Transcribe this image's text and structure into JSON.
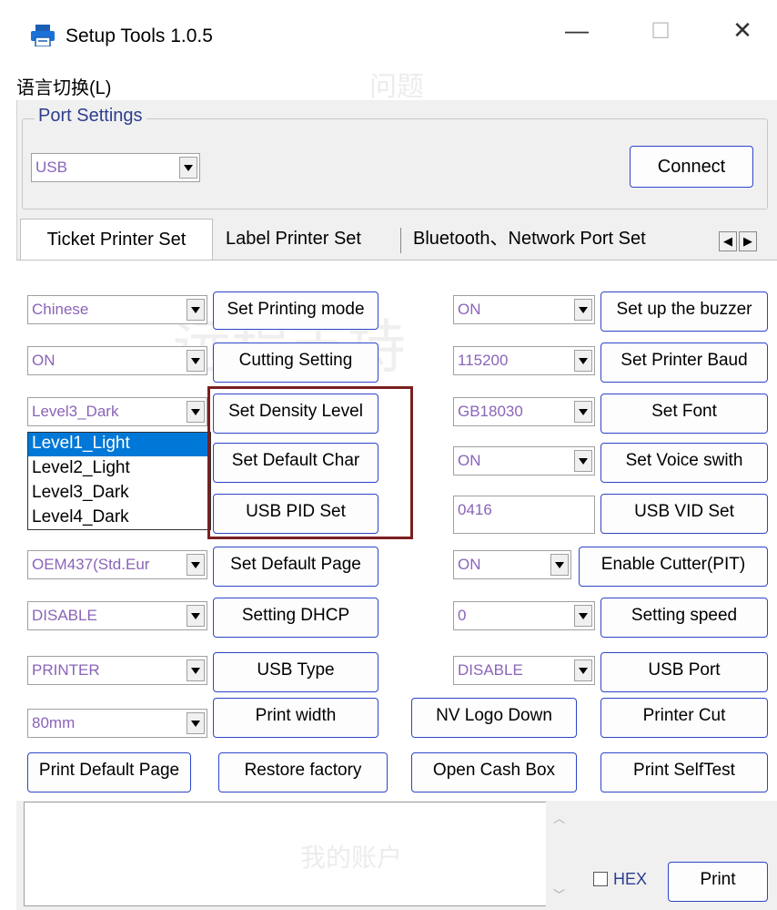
{
  "window": {
    "title": "Setup Tools 1.0.5",
    "minimize": "—",
    "maximize": "☐",
    "close": "✕"
  },
  "menu": {
    "language": "语言切换(L)"
  },
  "port_settings": {
    "label": "Port Settings",
    "port_value": "USB",
    "connect": "Connect"
  },
  "tabs": [
    {
      "label": "Ticket Printer Set"
    },
    {
      "label": "Label Printer Set"
    },
    {
      "label": "Bluetooth、Network Port Set"
    }
  ],
  "left_rows": [
    {
      "combo": "Chinese",
      "button": "Set Printing mode"
    },
    {
      "combo": "ON",
      "button": "Cutting Setting"
    },
    {
      "combo": "Level3_Dark",
      "button": "Set Density Level"
    },
    {
      "combo": "",
      "button": "Set Default Char"
    },
    {
      "combo": "",
      "button": "USB PID Set"
    },
    {
      "combo": "OEM437(Std.Eur",
      "button": "Set Default Page"
    },
    {
      "combo": "DISABLE",
      "button": "Setting DHCP"
    },
    {
      "combo": "PRINTER",
      "button": "USB Type"
    },
    {
      "combo": "80mm",
      "button": "Print width"
    }
  ],
  "right_rows": [
    {
      "combo": "ON",
      "button": "Set  up the buzzer"
    },
    {
      "combo": "115200",
      "button": "Set Printer Baud"
    },
    {
      "combo": "GB18030",
      "button": "Set Font"
    },
    {
      "combo": "ON",
      "button": "Set Voice swith"
    },
    {
      "input": "0416",
      "button": "USB VID Set"
    },
    {
      "combo": "ON",
      "button": "Enable Cutter(PIT)"
    },
    {
      "combo": "0",
      "button": "Setting speed"
    },
    {
      "combo": "DISABLE",
      "button": "USB Port"
    }
  ],
  "bottom_buttons": {
    "nv_logo": "NV Logo Down",
    "printer_cut": "Printer Cut",
    "print_default": "Print Default Page",
    "restore": "Restore factory",
    "cash_box": "Open Cash Box",
    "self_test": "Print SelfTest"
  },
  "density_dropdown": {
    "options": [
      "Level1_Light",
      "Level2_Light",
      "Level3_Dark",
      "Level4_Dark"
    ],
    "selected_index": 0
  },
  "footer": {
    "hex_label": "HEX",
    "print": "Print"
  },
  "watermarks": {
    "w1": "问题",
    "w2": "远程支持",
    "w3": "我的账户"
  },
  "colors": {
    "accent_border": "#2d45c8",
    "highlight": "#7a1f1f",
    "combo_text": "#8a64b8"
  }
}
